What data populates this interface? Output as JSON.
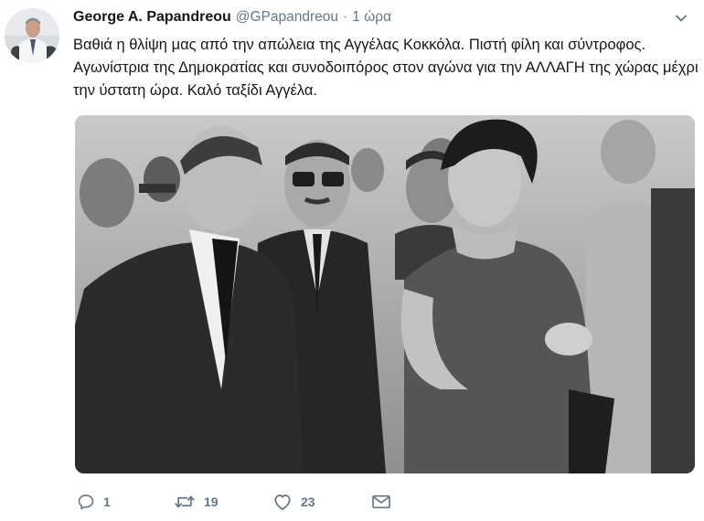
{
  "tweet": {
    "author_name": "George A. Papandreou",
    "author_handle": "@GPapandreou",
    "separator": "·",
    "time": "1 ώρα",
    "text": "Βαθιά η θλίψη μας από την απώλεια της Αγγέλας Κοκκόλα. Πιστή φίλη και σύντροφος. Αγωνίστρια της Δημοκρατίας και συνοδοιπόρος στον αγώνα για την ΑΛΛΑΓΗ της χώρας μέχρι την ύστατη ώρα. Καλό ταξίδι Αγγέλα.",
    "photo": {
      "description_icon": "black-and-white-photo"
    }
  },
  "actions": {
    "reply": {
      "icon": "reply-icon",
      "count": "1"
    },
    "retweet": {
      "icon": "retweet-icon",
      "count": "19"
    },
    "like": {
      "icon": "heart-icon",
      "count": "23"
    },
    "message": {
      "icon": "direct-message-icon"
    }
  },
  "colors": {
    "text": "#14171a",
    "secondary": "#657786"
  }
}
